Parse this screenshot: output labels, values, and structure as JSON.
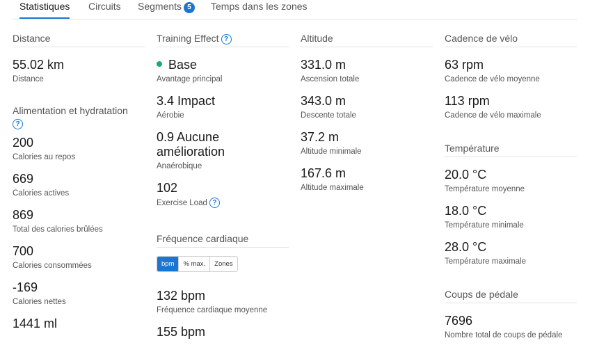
{
  "tabs": [
    {
      "label": "Statistiques"
    },
    {
      "label": "Circuits"
    },
    {
      "label": "Segments",
      "badge": "5"
    },
    {
      "label": "Temps dans les zones"
    }
  ],
  "col1": {
    "distance_title": "Distance",
    "distance": [
      {
        "value": "55.02 km",
        "label": "Distance"
      }
    ],
    "nutrition_title": "Alimentation et hydratation",
    "nutrition": [
      {
        "value": "200",
        "label": "Calories au repos"
      },
      {
        "value": "669",
        "label": "Calories actives"
      },
      {
        "value": "869",
        "label": "Total des calories brûlées"
      },
      {
        "value": "700",
        "label": "Calories consommées"
      },
      {
        "value": "-169",
        "label": "Calories nettes"
      },
      {
        "value": "1441 ml",
        "label": ""
      }
    ]
  },
  "col2": {
    "te_title": "Training Effect",
    "te": [
      {
        "value": "Base",
        "label": "Avantage principal"
      },
      {
        "value": "3.4 Impact",
        "label": "Aérobie"
      },
      {
        "value": "0.9 Aucune amélioration",
        "label": "Anaérobique"
      },
      {
        "value": "102",
        "label": "Exercise Load"
      }
    ],
    "hr_title": "Fréquence cardiaque",
    "hr_toggle": [
      "bpm",
      "% max.",
      "Zones"
    ],
    "hr": [
      {
        "value": "132 bpm",
        "label": "Fréquence cardiaque moyenne"
      },
      {
        "value": "155 bpm",
        "label": ""
      }
    ]
  },
  "col3": {
    "alt_title": "Altitude",
    "alt": [
      {
        "value": "331.0 m",
        "label": "Ascension totale"
      },
      {
        "value": "343.0 m",
        "label": "Descente totale"
      },
      {
        "value": "37.2 m",
        "label": "Altitude minimale"
      },
      {
        "value": "167.6 m",
        "label": "Altitude maximale"
      }
    ]
  },
  "col4": {
    "cad_title": "Cadence de vélo",
    "cad": [
      {
        "value": "63 rpm",
        "label": "Cadence de vélo moyenne"
      },
      {
        "value": "113 rpm",
        "label": "Cadence de vélo maximale"
      }
    ],
    "temp_title": "Température",
    "temp": [
      {
        "value": "20.0 °C",
        "label": "Température moyenne"
      },
      {
        "value": "18.0 °C",
        "label": "Température minimale"
      },
      {
        "value": "28.0 °C",
        "label": "Température maximale"
      }
    ],
    "ped_title": "Coups de pédale",
    "ped": [
      {
        "value": "7696",
        "label": "Nombre total de coups de pédale"
      }
    ]
  },
  "colors": {
    "accent": "#1976d2",
    "base_dot": "#19a974"
  }
}
